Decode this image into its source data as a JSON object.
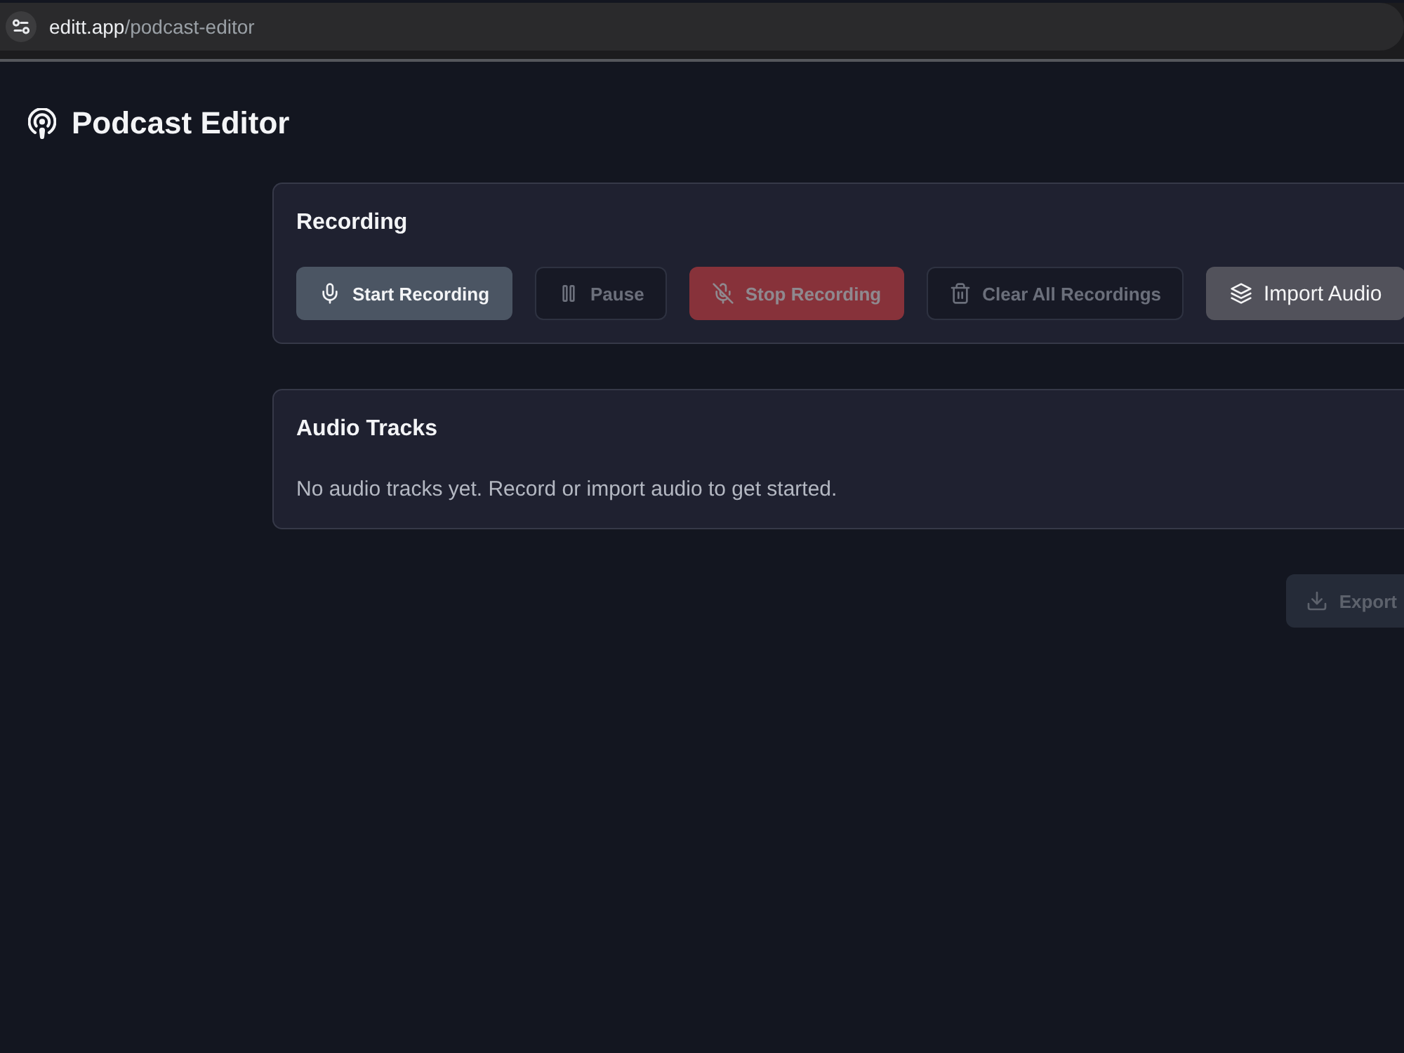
{
  "browser": {
    "url_host": "editt.app",
    "url_path": "/podcast-editor"
  },
  "header": {
    "title": "Podcast Editor"
  },
  "recording": {
    "title": "Recording",
    "buttons": [
      {
        "label": "Start Recording",
        "kind": "primary",
        "disabled": false
      },
      {
        "label": "Pause",
        "kind": "outline",
        "disabled": true
      },
      {
        "label": "Stop Recording",
        "kind": "danger",
        "disabled": true
      },
      {
        "label": "Clear All Recordings",
        "kind": "outline",
        "disabled": true
      },
      {
        "label": "Import Audio",
        "kind": "secondary",
        "disabled": false
      }
    ]
  },
  "tracks": {
    "title": "Audio Tracks",
    "empty_message": "No audio tracks yet. Record or import audio to get started."
  },
  "export_button": {
    "label": "Export",
    "kind": "muted",
    "disabled": true
  }
}
